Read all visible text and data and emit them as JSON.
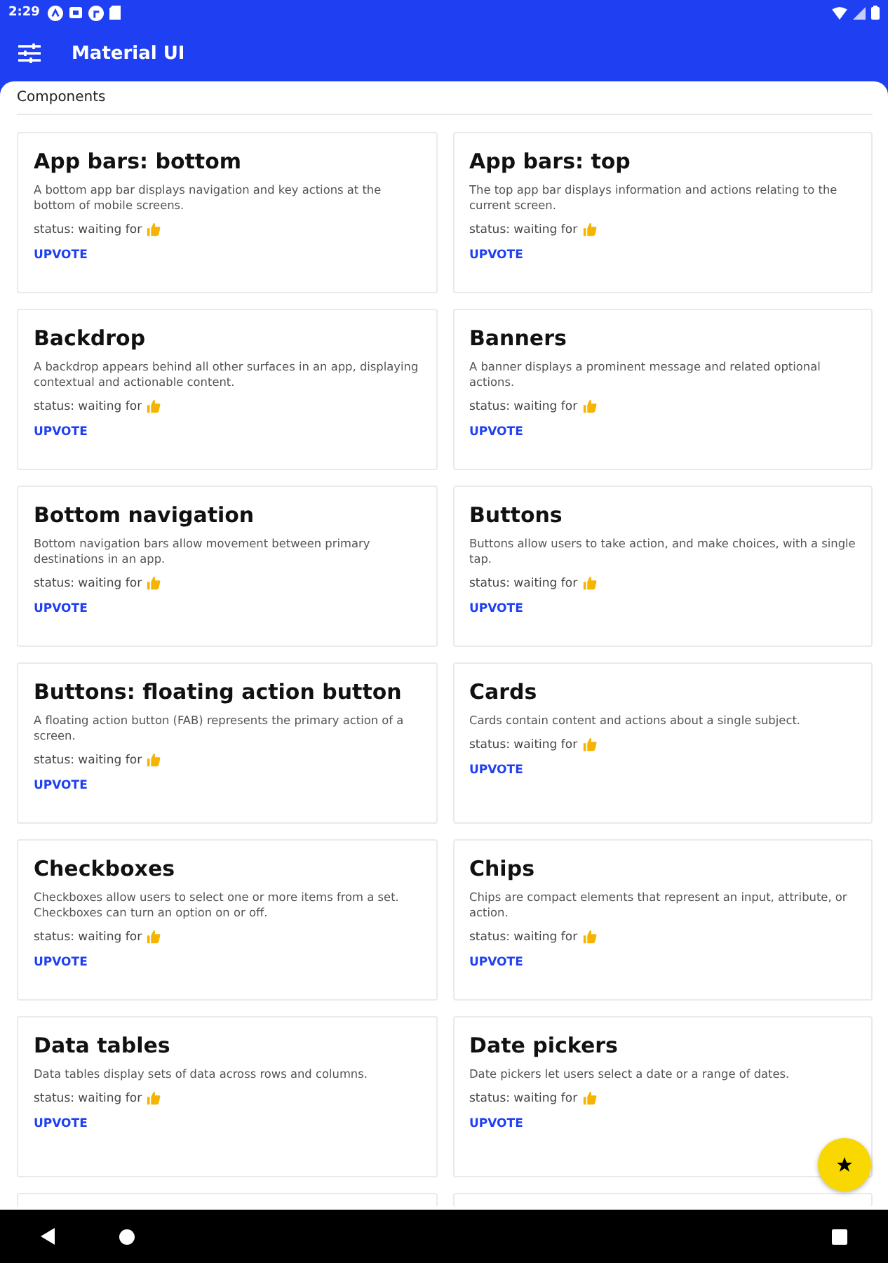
{
  "status_bar": {
    "time": "2:29"
  },
  "app_bar": {
    "title": "Material UI"
  },
  "section": {
    "title": "Components"
  },
  "cards": [
    {
      "title": "App bars: bottom",
      "description": "A bottom app bar displays navigation and key actions at the bottom of mobile screens.",
      "status": "status: waiting for",
      "action": "UPVOTE"
    },
    {
      "title": "App bars: top",
      "description": "The top app bar displays information and actions relating to the current screen.",
      "status": "status: waiting for",
      "action": "UPVOTE"
    },
    {
      "title": "Backdrop",
      "description": "A backdrop appears behind all other surfaces in an app, displaying contextual and actionable content.",
      "status": "status: waiting for",
      "action": "UPVOTE"
    },
    {
      "title": "Banners",
      "description": "A banner displays a prominent message and related optional actions.",
      "status": "status: waiting for",
      "action": "UPVOTE"
    },
    {
      "title": "Bottom navigation",
      "description": "Bottom navigation bars allow movement between primary destinations in an app.",
      "status": "status: waiting for",
      "action": "UPVOTE"
    },
    {
      "title": "Buttons",
      "description": "Buttons allow users to take action, and make choices, with a single tap.",
      "status": "status: waiting for",
      "action": "UPVOTE"
    },
    {
      "title": "Buttons: floating action button",
      "description": "A floating action button (FAB) represents the primary action of a screen.",
      "status": "status: waiting for",
      "action": "UPVOTE"
    },
    {
      "title": "Cards",
      "description": "Cards contain content and actions about a single subject.",
      "status": "status: waiting for",
      "action": "UPVOTE"
    },
    {
      "title": "Checkboxes",
      "description": "Checkboxes allow users to select one or more items from a set. Checkboxes can turn an option on or off.",
      "status": "status: waiting for",
      "action": "UPVOTE"
    },
    {
      "title": "Chips",
      "description": "Chips are compact elements that represent an input, attribute, or action.",
      "status": "status: waiting for",
      "action": "UPVOTE"
    },
    {
      "title": "Data tables",
      "description": "Data tables display sets of data across rows and columns.",
      "status": "status: waiting for",
      "action": "UPVOTE"
    },
    {
      "title": "Date pickers",
      "description": "Date pickers let users select a date or a range of dates.",
      "status": "status: waiting for",
      "action": "UPVOTE"
    }
  ]
}
